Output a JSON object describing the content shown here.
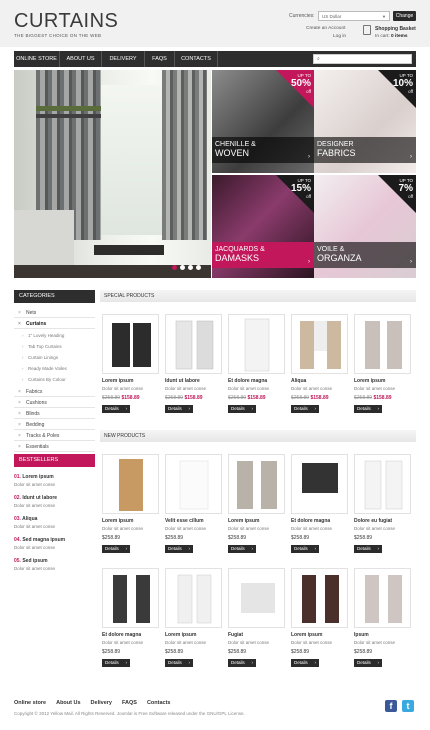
{
  "header": {
    "logo": "CURTAINS",
    "tagline": "THE BIGGEST CHOICE ON THE WEB",
    "currencies_label": "Currencies:",
    "currency_value": "US Dollar",
    "change_label": "Change",
    "account_text": "Create an Account",
    "login_text": "Log in",
    "basket_title": "Shopping Basket",
    "basket_count_prefix": "In cart:",
    "basket_count": "0 items"
  },
  "nav": {
    "items": [
      "ONLINE STORE",
      "ABOUT US",
      "DELIVERY",
      "FAQS",
      "CONTACTS"
    ],
    "search_icon": "magnifier-icon"
  },
  "banner": {
    "tiles": [
      {
        "t1": "CHENILLE &",
        "t2": "WOVEN",
        "label": "UP TO",
        "pct": "50%",
        "sub": "off"
      },
      {
        "t1": "DESIGNER",
        "t2": "FABRICS",
        "label": "UP TO",
        "pct": "10%",
        "sub": "off"
      },
      {
        "t1": "JACQUARDS &",
        "t2": "DAMASKS",
        "label": "UP TO",
        "pct": "15%",
        "sub": "off"
      },
      {
        "t1": "VOILE &",
        "t2": "ORGANZA",
        "label": "UP TO",
        "pct": "7%",
        "sub": "off"
      }
    ]
  },
  "sidebar": {
    "categories_title": "CATEGORIES",
    "cat_top": [
      "Nets",
      "Curtains"
    ],
    "subcats": [
      "1\" Lovely Heading",
      "Tab Top Curtains",
      "Curtain Linings",
      "Ready Made Voiles",
      "Curtains By Colour"
    ],
    "cat_bottom": [
      "Fabrics",
      "Cushions",
      "Blinds",
      "Bedding",
      "Tracks & Poles",
      "Essentials"
    ],
    "bestsellers_title": "BESTSELLERS",
    "bestsellers": [
      {
        "num": "01.",
        "name": "Lorem ipsum",
        "desc": "Dolor sit amet conse"
      },
      {
        "num": "02.",
        "name": "Idunt ut labore",
        "desc": "Dolor sit amet conse"
      },
      {
        "num": "03.",
        "name": "Aliqua",
        "desc": "Dolor sit amet conse"
      },
      {
        "num": "04.",
        "name": "Sed magna ipsum",
        "desc": "Dolor sit amet conse"
      },
      {
        "num": "05.",
        "name": "Sed ipsum",
        "desc": "Dolor sit amet conse"
      }
    ]
  },
  "special": {
    "title": "SPECIAL PRODUCTS",
    "details": "Details",
    "items": [
      {
        "name": "Lorem ipsum",
        "desc": "Dolor sit amet conse",
        "old": "$258.89",
        "new": "$158.89"
      },
      {
        "name": "Idunt ut labore",
        "desc": "Dolor sit amet conse",
        "old": "$258.89",
        "new": "$158.89"
      },
      {
        "name": "Et dolore magna",
        "desc": "Dolor sit amet conse",
        "old": "$258.89",
        "new": "$158.89"
      },
      {
        "name": "Aliqua",
        "desc": "Dolor sit amet conse",
        "old": "$258.89",
        "new": "$158.89"
      },
      {
        "name": "Lorem ipsum",
        "desc": "Dolor sit amet conse",
        "old": "$258.89",
        "new": "$158.89"
      }
    ]
  },
  "new_products": {
    "title": "NEW PRODUCTS",
    "details": "Details",
    "items": [
      {
        "name": "Lorem ipsum",
        "desc": "Dolor sit amet conse",
        "price": "$258.89"
      },
      {
        "name": "Velit esse cillum",
        "desc": "Dolor sit amet conse",
        "price": "$258.89"
      },
      {
        "name": "Lorem ipsum",
        "desc": "Dolor sit amet conse",
        "price": "$258.89"
      },
      {
        "name": "Et dolore magna",
        "desc": "Dolor sit amet conse",
        "price": "$258.89"
      },
      {
        "name": "Dolore eu fugiat",
        "desc": "Dolor sit amet conse",
        "price": "$258.89"
      },
      {
        "name": "Et dolore magna",
        "desc": "Dolor sit amet conse",
        "price": "$258.89"
      },
      {
        "name": "Lorem ipsum",
        "desc": "Dolor sit amet conse",
        "price": "$258.89"
      },
      {
        "name": "Fugiat",
        "desc": "Dolor sit amet conse",
        "price": "$258.89"
      },
      {
        "name": "Lorem ipsum",
        "desc": "Dolor sit amet conse",
        "price": "$258.89"
      },
      {
        "name": "Ipsum",
        "desc": "Dolor sit amet conse",
        "price": "$258.89"
      }
    ]
  },
  "footer": {
    "links": [
      "Online store",
      "About Us",
      "Delivery",
      "FAQS",
      "Contacts"
    ],
    "copyright": "Copyright © 2012 Yellow Mail. All Rights Reserved. Joomla! is Free Software released under the GNU/GPL License."
  },
  "colors": {
    "accent": "#c2185b",
    "dark": "#2e2e2e"
  }
}
